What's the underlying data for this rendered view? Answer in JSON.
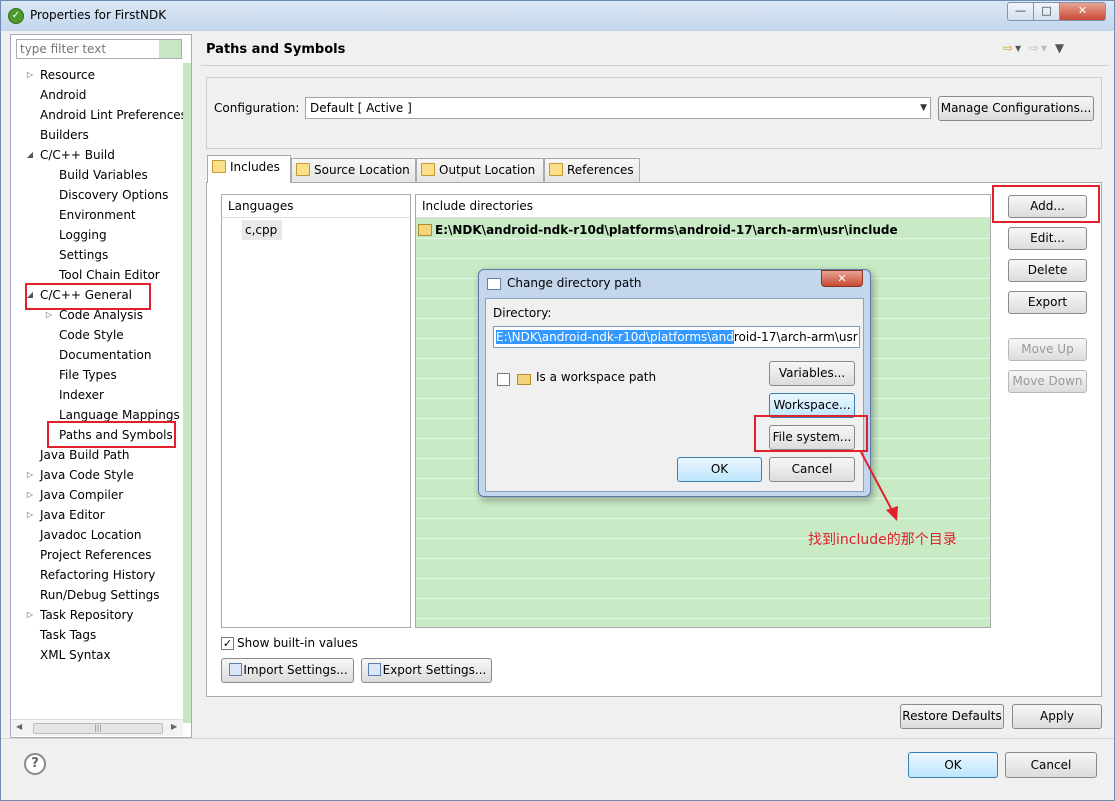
{
  "window": {
    "title": "Properties for FirstNDK"
  },
  "filter": {
    "placeholder": "type filter text"
  },
  "tree": [
    {
      "label": "Resource",
      "level": 0,
      "twisty": "closed"
    },
    {
      "label": "Android",
      "level": 0,
      "twisty": ""
    },
    {
      "label": "Android Lint Preferences",
      "level": 0,
      "twisty": ""
    },
    {
      "label": "Builders",
      "level": 0,
      "twisty": ""
    },
    {
      "label": "C/C++ Build",
      "level": 0,
      "twisty": "open"
    },
    {
      "label": "Build Variables",
      "level": 1,
      "twisty": ""
    },
    {
      "label": "Discovery Options",
      "level": 1,
      "twisty": ""
    },
    {
      "label": "Environment",
      "level": 1,
      "twisty": ""
    },
    {
      "label": "Logging",
      "level": 1,
      "twisty": ""
    },
    {
      "label": "Settings",
      "level": 1,
      "twisty": ""
    },
    {
      "label": "Tool Chain Editor",
      "level": 1,
      "twisty": ""
    },
    {
      "label": "C/C++ General",
      "level": 0,
      "twisty": "open"
    },
    {
      "label": "Code Analysis",
      "level": 1,
      "twisty": "closed"
    },
    {
      "label": "Code Style",
      "level": 1,
      "twisty": ""
    },
    {
      "label": "Documentation",
      "level": 1,
      "twisty": ""
    },
    {
      "label": "File Types",
      "level": 1,
      "twisty": ""
    },
    {
      "label": "Indexer",
      "level": 1,
      "twisty": ""
    },
    {
      "label": "Language Mappings",
      "level": 1,
      "twisty": ""
    },
    {
      "label": "Paths and Symbols",
      "level": 1,
      "twisty": ""
    },
    {
      "label": "Java Build Path",
      "level": 0,
      "twisty": ""
    },
    {
      "label": "Java Code Style",
      "level": 0,
      "twisty": "closed"
    },
    {
      "label": "Java Compiler",
      "level": 0,
      "twisty": "closed"
    },
    {
      "label": "Java Editor",
      "level": 0,
      "twisty": "closed"
    },
    {
      "label": "Javadoc Location",
      "level": 0,
      "twisty": ""
    },
    {
      "label": "Project References",
      "level": 0,
      "twisty": ""
    },
    {
      "label": "Refactoring History",
      "level": 0,
      "twisty": ""
    },
    {
      "label": "Run/Debug Settings",
      "level": 0,
      "twisty": ""
    },
    {
      "label": "Task Repository",
      "level": 0,
      "twisty": "closed"
    },
    {
      "label": "Task Tags",
      "level": 0,
      "twisty": ""
    },
    {
      "label": "XML Syntax",
      "level": 0,
      "twisty": ""
    }
  ],
  "page": {
    "title": "Paths and Symbols",
    "configuration_label": "Configuration:",
    "configuration_value": "Default  [ Active ]",
    "manage_configurations": "Manage Configurations...",
    "tabs": [
      "Includes",
      "Source Location",
      "Output Location",
      "References"
    ],
    "languages_header": "Languages",
    "languages": [
      "c,cpp"
    ],
    "include_header": "Include directories",
    "include_dirs": [
      "E:\\NDK\\android-ndk-r10d\\platforms\\android-17\\arch-arm\\usr\\include"
    ],
    "side_buttons": {
      "add": "Add...",
      "edit": "Edit...",
      "delete": "Delete",
      "export": "Export",
      "move_up": "Move Up",
      "move_down": "Move Down"
    },
    "show_builtin": "Show built-in values",
    "import_settings": "Import Settings...",
    "export_settings": "Export Settings...",
    "restore_defaults": "Restore Defaults",
    "apply": "Apply"
  },
  "dialog": {
    "title": "Change directory path",
    "directory_label": "Directory:",
    "directory_selected": "E:\\NDK\\android-ndk-r10d\\platforms\\and",
    "directory_rest": "roid-17\\arch-arm\\usr",
    "workspace_path_label": "Is a workspace path",
    "variables": "Variables...",
    "workspace": "Workspace...",
    "file_system": "File system...",
    "ok": "OK",
    "cancel": "Cancel"
  },
  "annotation": "找到include的那个目录",
  "footer": {
    "ok": "OK",
    "cancel": "Cancel"
  },
  "colors": {
    "highlight_red": "#e0202b",
    "list_green": "#c8ebc5",
    "selection_blue": "#3399ff"
  }
}
